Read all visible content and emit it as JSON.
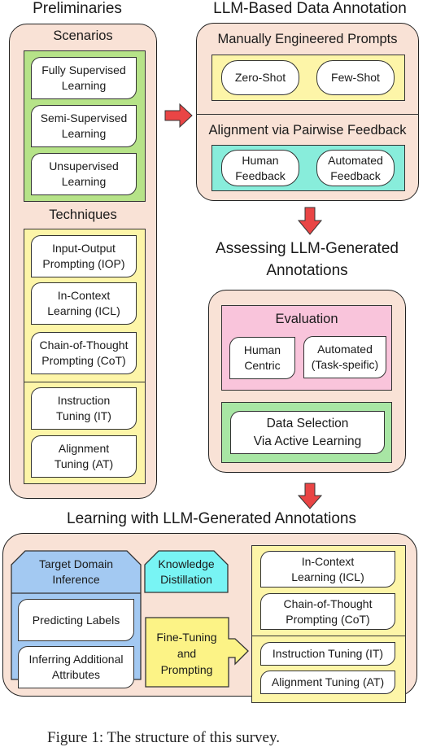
{
  "figure": {
    "caption": "Figure 1: The structure of this survey.",
    "colors": {
      "section_fill": "#f9e2d6",
      "scenarios_panel": "#b6e388",
      "techniques_panel": "#fdf5a8",
      "prompts_panel": "#fdf5a8",
      "feedback_panel": "#88eddb",
      "evaluation_panel": "#f9c4db",
      "selection_panel": "#a8e6a4",
      "target_domain_panel": "#a3c9f2",
      "distillation_panel": "#78f4f4",
      "finetune_panel": "#fcf386",
      "arrow": "#e94545"
    }
  },
  "preliminaries": {
    "title": "Preliminaries",
    "scenarios": {
      "title": "Scenarios",
      "items": [
        [
          "Fully Supervised",
          "Learning"
        ],
        [
          "Semi-Supervised",
          "Learning"
        ],
        [
          "Unsupervised",
          "Learning"
        ]
      ]
    },
    "techniques": {
      "title": "Techniques",
      "prompting_items": [
        [
          "Input-Output",
          "Prompting (IOP)"
        ],
        [
          "In-Context",
          "Learning (ICL)"
        ],
        [
          "Chain-of-Thought",
          "Prompting (CoT)"
        ]
      ],
      "tuning_items": [
        [
          "Instruction",
          "Tuning (IT)"
        ],
        [
          "Alignment",
          "Tuning (AT)"
        ]
      ]
    }
  },
  "annotation": {
    "title": "LLM-Based Data Annotation",
    "prompts": {
      "title": "Manually Engineered Prompts",
      "items": [
        "Zero-Shot",
        "Few-Shot"
      ]
    },
    "feedback": {
      "title": "Alignment via Pairwise Feedback",
      "items": [
        [
          "Human",
          "Feedback"
        ],
        [
          "Automated",
          "Feedback"
        ]
      ]
    }
  },
  "assessing": {
    "title_lines": [
      "Assessing LLM-Generated",
      "Annotations"
    ],
    "evaluation": {
      "title": "Evaluation",
      "items": [
        [
          "Human",
          "Centric"
        ],
        [
          "Automated",
          "(Task-speific)"
        ]
      ]
    },
    "selection": {
      "lines": [
        "Data Selection",
        "Via Active Learning"
      ]
    }
  },
  "learning": {
    "title": "Learning with LLM-Generated Annotations",
    "target_domain": {
      "title_lines": [
        "Target Domain",
        "Inference"
      ],
      "items": [
        [
          "Predicting Labels"
        ],
        [
          "Inferring Additional",
          "Attributes"
        ]
      ]
    },
    "distillation": {
      "title_lines": [
        "Knowledge",
        "Distillation"
      ]
    },
    "finetuning": {
      "title_lines": [
        "Fine-Tuning",
        "and",
        "Prompting"
      ]
    },
    "prompting_items": [
      [
        "In-Context",
        "Learning (ICL)"
      ],
      [
        "Chain-of-Thought",
        "Prompting (CoT)"
      ]
    ],
    "tuning_items": [
      [
        "Instruction Tuning (IT)"
      ],
      [
        "Alignment Tuning (AT)"
      ]
    ]
  }
}
